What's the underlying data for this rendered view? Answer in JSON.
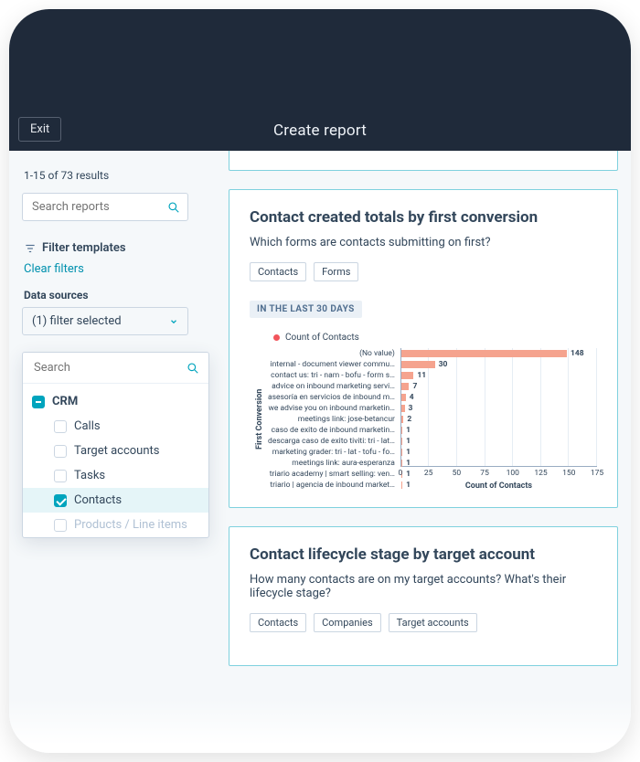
{
  "header": {
    "exit_label": "Exit",
    "title": "Create report"
  },
  "sidebar": {
    "results": "1-15 of 73 results",
    "search_placeholder": "Search reports",
    "filter_heading": "Filter templates",
    "clear_label": "Clear filters",
    "datasources_label": "Data sources",
    "dropdown_value": "(1) filter selected",
    "panel": {
      "search_placeholder": "Search",
      "group": "CRM",
      "items": [
        {
          "label": "Calls",
          "checked": false
        },
        {
          "label": "Target accounts",
          "checked": false
        },
        {
          "label": "Tasks",
          "checked": false
        },
        {
          "label": "Contacts",
          "checked": true
        },
        {
          "label": "Products / Line items",
          "checked": false,
          "faded": true
        }
      ]
    }
  },
  "cards": {
    "c1": {
      "title": "Contact created totals by first conversion",
      "subtitle": "Which forms are contacts submitting on first?",
      "tag0": "Contacts",
      "tag1": "Forms",
      "range": "IN THE LAST 30 DAYS",
      "legend": "Count of Contacts",
      "xlabel": "Count of Contacts",
      "ylabel": "First Conversion"
    },
    "c2": {
      "title": "Contact lifecycle stage by target account",
      "subtitle": "How many contacts are on my target accounts? What's their lifecycle stage?",
      "tag0": "Contacts",
      "tag1": "Companies",
      "tag2": "Target accounts"
    }
  },
  "chart_data": {
    "type": "bar",
    "orientation": "horizontal",
    "title": "Contact created totals by first conversion",
    "xlabel": "Count of Contacts",
    "ylabel": "First Conversion",
    "xlim": [
      0,
      175
    ],
    "xticks": [
      0,
      25,
      50,
      75,
      100,
      125,
      150,
      175
    ],
    "series_name": "Count of Contacts",
    "series_color": "#f5a38e",
    "categories": [
      "(No value)",
      "internal - document viewer commu…",
      "contact us: tri - nam - bofu - form s…",
      "advice on inbound marketing servi…",
      "asesoría en servicios de inbound m…",
      "we advise you on inbound marketin…",
      "meetings link: jose-betancur",
      "caso de exito de inbound marketin…",
      "descarga caso de exito tiviti: tri - lat…",
      "marketing grader: tri - lat - tofu - fo…",
      "meetings link: aura-esperanza",
      "triario academy | smart selling: ven…",
      "triario | agencia de inbound market…"
    ],
    "values": [
      148,
      30,
      11,
      7,
      4,
      3,
      2,
      1,
      1,
      1,
      1,
      1,
      1
    ]
  }
}
